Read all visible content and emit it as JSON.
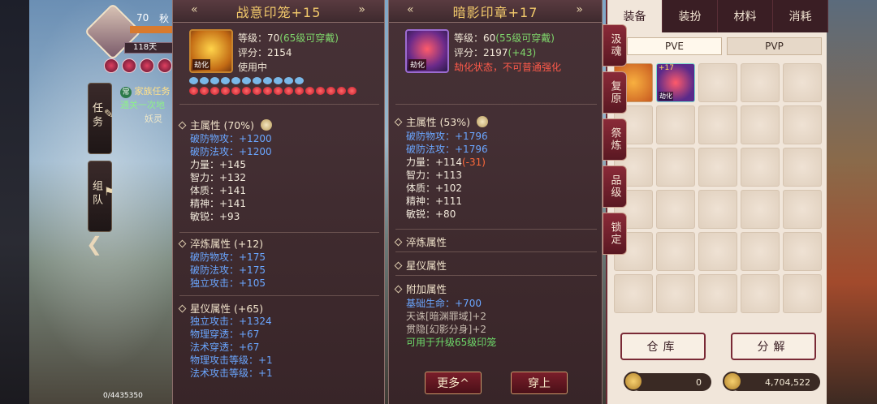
{
  "hud": {
    "level": "70",
    "name": "秋",
    "days": "118天",
    "tab_task": "任务",
    "tab_team": "组队",
    "quest_tag": "常",
    "quest_name": "家族任务",
    "quest_progress": "通关一次地",
    "quest_target": "妖灵",
    "exp": "0/4435350"
  },
  "panel1": {
    "title": "战意印笼+15",
    "icon_badge": "劫化",
    "level_label": "等级：70",
    "level_note": "(65级可穿戴)",
    "score": "评分：2154",
    "status": "使用中",
    "main_attr": "主属性 (70%)",
    "main_stats": [
      {
        "text": "破防物攻：+1200",
        "color": "blue"
      },
      {
        "text": "破防法攻：+1200",
        "color": "blue"
      },
      {
        "text": "力量：+145",
        "color": "white"
      },
      {
        "text": "智力：+132",
        "color": "white"
      },
      {
        "text": "体质：+141",
        "color": "white"
      },
      {
        "text": "精神：+141",
        "color": "white"
      },
      {
        "text": "敏锐：+93",
        "color": "white"
      }
    ],
    "refine_attr": "淬炼属性 (+12)",
    "refine_stats": [
      "破防物攻：+175",
      "破防法攻：+175",
      "独立攻击：+105"
    ],
    "star_attr": "星仪属性 (+65)",
    "star_stats": [
      "独立攻击：+1324",
      "物理穿透：+67",
      "法术穿透：+67",
      "物理攻击等级：+1",
      "法术攻击等级：+1"
    ]
  },
  "panel2": {
    "title": "暗影印章+17",
    "icon_badge": "劫化",
    "level_label": "等级：60",
    "level_note": "(55级可穿戴)",
    "score": "评分：2197",
    "score_delta": "(+43)",
    "status": "劫化状态，不可普通强化",
    "main_attr": "主属性 (53%)",
    "main_stats": [
      {
        "text": "破防物攻：+1796",
        "color": "blue"
      },
      {
        "text": "破防法攻：+1796",
        "color": "blue"
      },
      {
        "text": "力量：+114",
        "color": "white",
        "delta": "(-31)"
      },
      {
        "text": "智力：+113",
        "color": "white"
      },
      {
        "text": "体质：+102",
        "color": "white"
      },
      {
        "text": "精神：+111",
        "color": "white"
      },
      {
        "text": "敏锐：+80",
        "color": "white"
      }
    ],
    "refine_attr": "淬炼属性",
    "star_attr": "星仪属性",
    "extra_attr": "附加属性",
    "extra_stats": [
      {
        "text": "基础生命：+700",
        "color": "blue"
      },
      {
        "text": "天诛[暗渊罪域]+2",
        "color": "gray"
      },
      {
        "text": "贯隐[幻影分身]+2",
        "color": "gray"
      },
      {
        "text": "可用于升级65级印笼",
        "color": "green"
      }
    ],
    "btn_more": "更多^",
    "btn_equip": "穿上"
  },
  "inventory": {
    "tabs": [
      "装备",
      "装扮",
      "材料",
      "消耗"
    ],
    "active_tab": 0,
    "sub_tabs": [
      "PVE",
      "PVP"
    ],
    "side_tabs": [
      "汲魂",
      "复原",
      "祭炼",
      "品级",
      "锁定"
    ],
    "item_label": "劫化",
    "item_plus": "+17",
    "btn_storage": "仓库",
    "btn_decompose": "分解",
    "currency1": "0",
    "currency2": "4,704,522"
  }
}
